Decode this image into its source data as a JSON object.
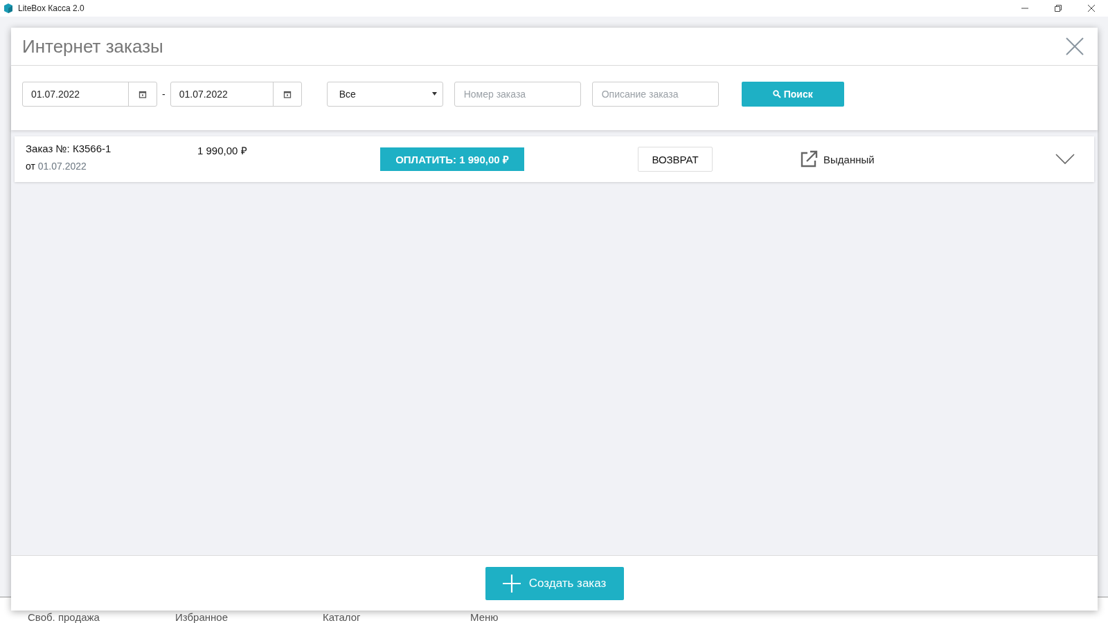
{
  "window": {
    "title": "LiteBox Касса 2.0"
  },
  "background_tabs": [
    {
      "label": "Своб. продажа"
    },
    {
      "label": "Избранное"
    },
    {
      "label": "Каталог"
    },
    {
      "label": "Меню"
    }
  ],
  "dialog": {
    "title": "Интернет заказы",
    "filters": {
      "date_from": "01.07.2022",
      "separator": "-",
      "date_to": "01.07.2022",
      "status": "Все",
      "order_number": {
        "placeholder": "Номер заказа"
      },
      "description": {
        "placeholder": "Описание заказа"
      },
      "search_button": "Поиск"
    },
    "orders": [
      {
        "number_label": "Заказ №: К3566-1",
        "date_prefix": "от",
        "date": "01.07.2022",
        "amount": "1 990,00 ₽",
        "pay_button": "ОПЛАТИТЬ: 1 990,00 ₽",
        "return_button": "ВОЗВРАТ",
        "status": "Выданный",
        "expanded": false
      }
    ],
    "create_button": "Создать заказ"
  }
}
